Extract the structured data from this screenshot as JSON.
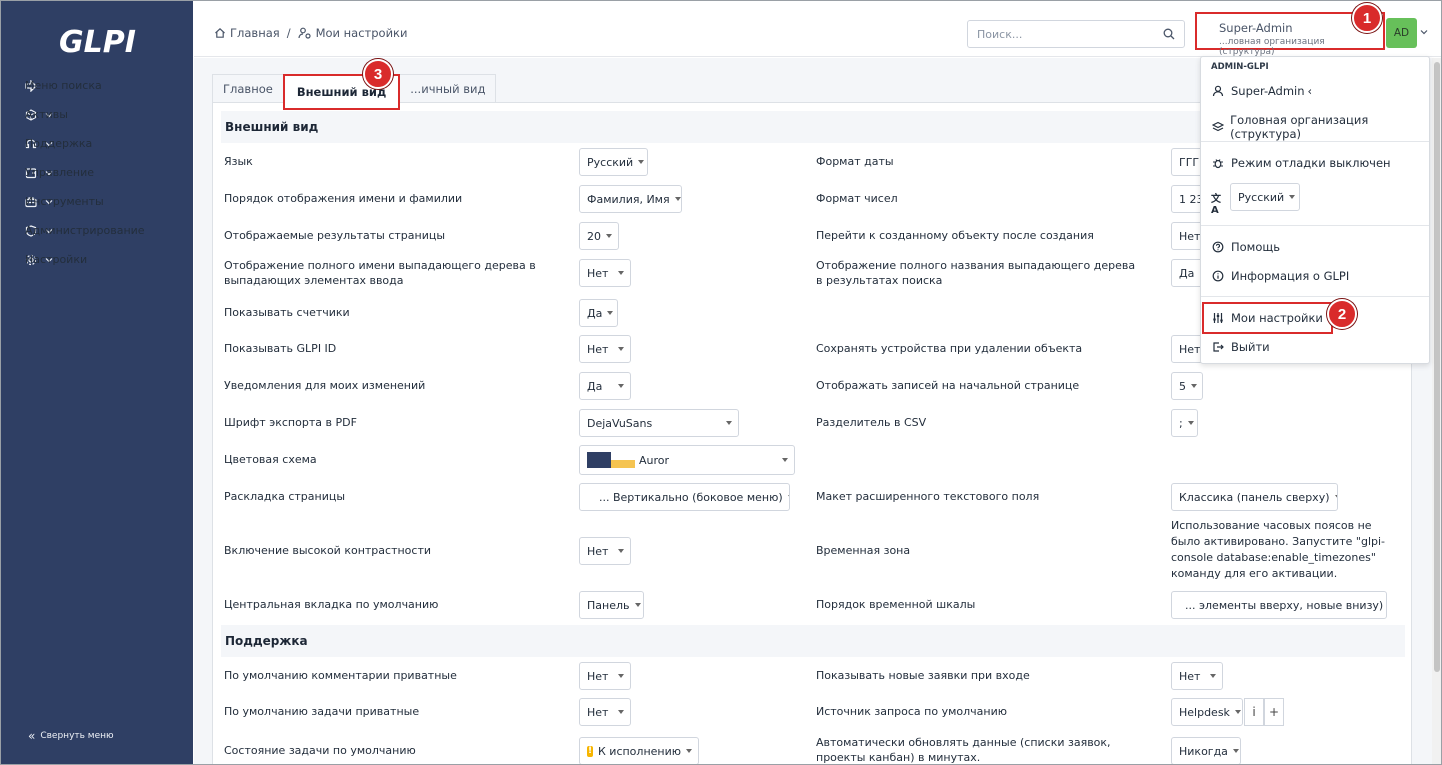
{
  "brand": {
    "logo_text": "GLPI",
    "sidebar_bg": "#2f3f64",
    "accent_red": "#d92b2b",
    "avatar_green": "#67c05a"
  },
  "sidebar": {
    "items": [
      {
        "label": "Меню поиска",
        "icon": "arrow-right-icon",
        "chevron": false
      },
      {
        "label": "Активы",
        "icon": "cube-icon",
        "chevron": true
      },
      {
        "label": "Поддержка",
        "icon": "headset-icon",
        "chevron": true
      },
      {
        "label": "Управление",
        "icon": "wallet-icon",
        "chevron": true
      },
      {
        "label": "Инструменты",
        "icon": "briefcase-icon",
        "chevron": true
      },
      {
        "label": "Администрирование",
        "icon": "shield-icon",
        "chevron": true
      },
      {
        "label": "Настройки",
        "icon": "gear-icon",
        "chevron": true
      }
    ],
    "collapse_label": "Свернуть меню"
  },
  "header": {
    "breadcrumb": [
      "Главная",
      "Мои настройки"
    ],
    "search_placeholder": "Поиск...",
    "user_name": "Super-Admin",
    "user_entity": "...ловная организация (структура)",
    "avatar_initials": "AD"
  },
  "badges": [
    "1",
    "2",
    "3"
  ],
  "tabs": [
    "Главное",
    "Внешний вид",
    "...ичный вид"
  ],
  "dropdown": {
    "header": "ADMIN-GLPI",
    "profile": "Super-Admin",
    "entity": "Головная организация (структура)",
    "debug": "Режим отладки выключен",
    "language": "Русский",
    "help": "Помощь",
    "about": "Информация о GLPI",
    "settings": "Мои настройки",
    "logout": "Выйти"
  },
  "sections": {
    "appearance": "Внешний вид",
    "support": "Поддержка"
  },
  "left_fields": [
    {
      "label": "Язык",
      "value": "Русский"
    },
    {
      "label": "Порядок отображения имени и фамилии",
      "value": "Фамилия, Имя"
    },
    {
      "label": "Отображаемые результаты страницы",
      "value": "20"
    },
    {
      "label": "Отображение полного имени выпадающего дерева в выпадающих элементах ввода",
      "value": "Нет"
    },
    {
      "label": "Показывать счетчики",
      "value": "Да"
    },
    {
      "label": "Показывать GLPI ID",
      "value": "Нет"
    },
    {
      "label": "Уведомления для моих изменений",
      "value": "Да"
    },
    {
      "label": "Шрифт экспорта в PDF",
      "value": "DejaVuSans"
    },
    {
      "label": "Цветовая схема",
      "value": "Auror"
    },
    {
      "label": "Раскладка страницы",
      "value": "... Вертикально (боковое меню)"
    },
    {
      "label": "Включение высокой контрастности",
      "value": "Нет"
    },
    {
      "label": "Центральная вкладка по умолчанию",
      "value": "Панель"
    }
  ],
  "right_fields": [
    {
      "label": "Формат даты",
      "value": "ГГГ"
    },
    {
      "label": "Формат чисел",
      "value": "1 23"
    },
    {
      "label": "Перейти к созданному объекту после создания",
      "value": "Нет"
    },
    {
      "label": "Отображение полного названия выпадающего дерева в результатах поиска",
      "value": "Да"
    },
    {
      "label": "Сохранять устройства при удалении объекта",
      "value": "Нет"
    },
    {
      "label": "Отображать записей на начальной странице",
      "value": "5"
    },
    {
      "label": "Разделитель в CSV",
      "value": ";"
    },
    {
      "label": "Макет расширенного текстового поля",
      "value": "Классика (панель сверху)"
    },
    {
      "label": "Временная зона",
      "value": "Использование часовых поясов не было активировано. Запустите \"glpi-console database:enable_timezones\" команду для его активации."
    },
    {
      "label": "Порядок временной шкалы",
      "value": "... элементы вверху, новые внизу)"
    }
  ],
  "support_left": [
    {
      "label": "По умолчанию комментарии приватные",
      "value": "Нет"
    },
    {
      "label": "По умолчанию задачи приватные",
      "value": "Нет"
    },
    {
      "label": "Состояние задачи по умолчанию",
      "value": "К исполнению"
    }
  ],
  "support_right": [
    {
      "label": "Показывать новые заявки при входе",
      "value": "Нет"
    },
    {
      "label": "Источник запроса по умолчанию",
      "value": "Helpdesk"
    },
    {
      "label": "Автоматически обновлять данные (списки заявок, проекты канбан) в минутах.",
      "value": "Никогда"
    }
  ],
  "mini_buttons": {
    "info": "i",
    "add": "+"
  },
  "scheme_colors": [
    "#2f3f64",
    "#f5c451",
    "#dfe4ee"
  ]
}
